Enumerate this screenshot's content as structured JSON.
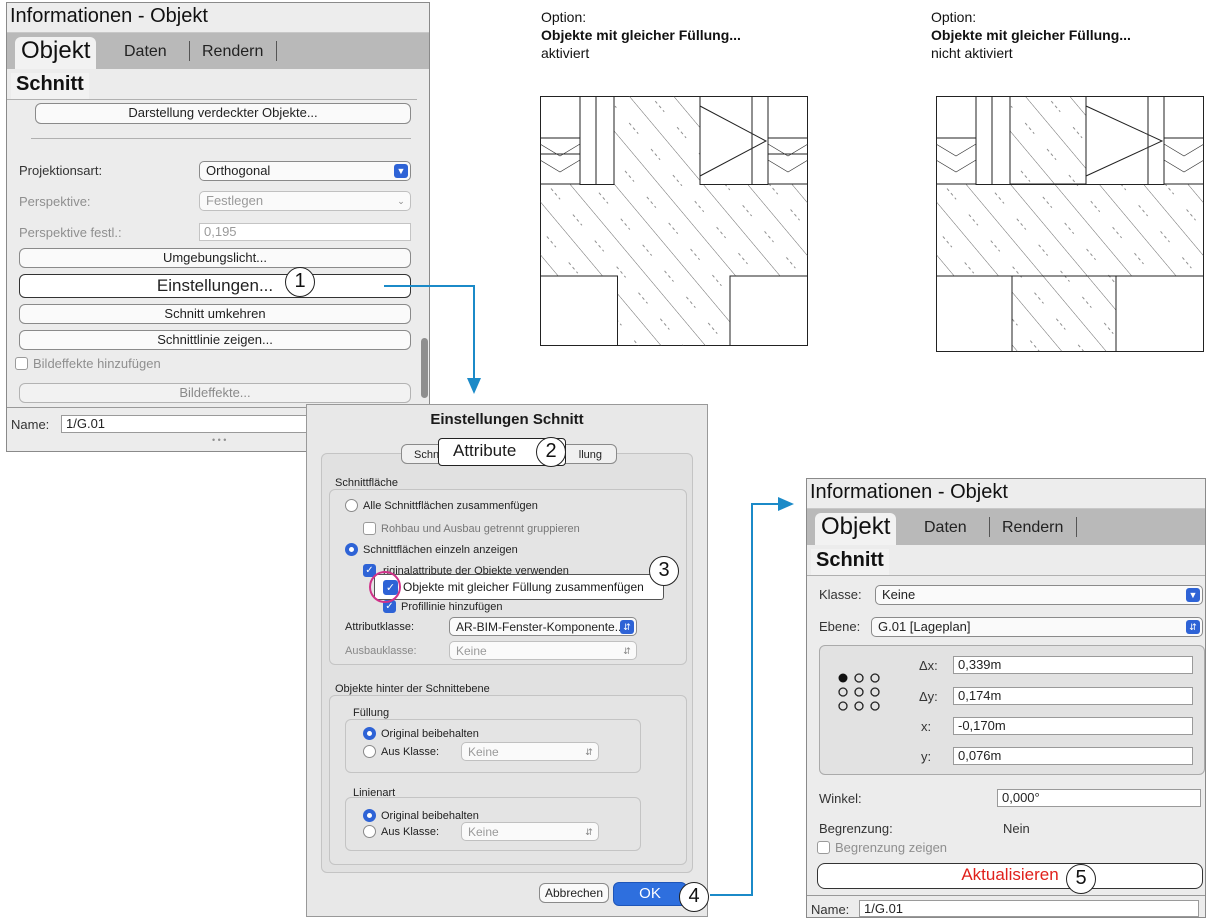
{
  "left_panel": {
    "title": "Informationen - Objekt",
    "tabs": [
      "Objekt",
      "Daten",
      "Rendern"
    ],
    "subtab": "Schnitt",
    "buttons": {
      "hidden_objects": "Darstellung verdeckter Objekte...",
      "ambient_light": "Umgebungslicht...",
      "settings": "Einstellungen...",
      "reverse": "Schnitt umkehren",
      "show_line": "Schnittlinie zeigen...",
      "effects": "Bildeffekte..."
    },
    "projection": {
      "label": "Projektionsart:",
      "value": "Orthogonal"
    },
    "perspective": {
      "label": "Perspektive:",
      "value": "Festlegen"
    },
    "perspective_fixed": {
      "label": "Perspektive festl.:",
      "value": "0,195"
    },
    "add_effects": "Bildeffekte hinzufügen",
    "name": {
      "label": "Name:",
      "value": "1/G.01"
    }
  },
  "dialog": {
    "title": "Einstellungen Schnitt",
    "tab_left_fragment": "Schni",
    "tab_right_fragment": "llung",
    "tab_active": "Attribute",
    "section_cut": "Schnittfläche",
    "merge_all": "Alle Schnittflächen zusammenfügen",
    "group_separate": "Rohbau und Ausbau getrennt gruppieren",
    "show_individually": "Schnittflächen einzeln anzeigen",
    "use_original": "riginalattribute der Objekte verwenden",
    "merge_same_fill": "Objekte mit gleicher Füllung zusammenfügen",
    "add_profile": "Profillinie hinzufügen",
    "attr_class": {
      "label": "Attributklasse:",
      "value": "AR-BIM-Fenster-Komponente..."
    },
    "finish_class": {
      "label": "Ausbauklasse:",
      "value": "Keine"
    },
    "section_behind": "Objekte hinter der Schnittebene",
    "fill_group": "Füllung",
    "line_group": "Linienart",
    "keep_original": "Original beibehalten",
    "from_class": "Aus Klasse:",
    "class_none": "Keine",
    "cancel": "Abbrechen",
    "ok": "OK"
  },
  "right_panel": {
    "title": "Informationen - Objekt",
    "tabs": [
      "Objekt",
      "Daten",
      "Rendern"
    ],
    "subtab": "Schnitt",
    "klasse": {
      "label": "Klasse:",
      "value": "Keine"
    },
    "ebene": {
      "label": "Ebene:",
      "value": "G.01 [Lageplan]"
    },
    "coords": [
      {
        "label": "Δx:",
        "value": "0,339m"
      },
      {
        "label": "Δy:",
        "value": "0,174m"
      },
      {
        "label": "x:",
        "value": "-0,170m"
      },
      {
        "label": "y:",
        "value": "0,076m"
      }
    ],
    "winkel": {
      "label": "Winkel:",
      "value": "0,000°"
    },
    "begrenzung": {
      "label": "Begrenzung:",
      "value": "Nein"
    },
    "show_bounds": "Begrenzung zeigen",
    "update": "Aktualisieren",
    "name": {
      "label": "Name:",
      "value": "1/G.01"
    }
  },
  "options": [
    {
      "prefix": "Option:",
      "bold": "Objekte mit gleicher Füllung...",
      "state": "aktiviert"
    },
    {
      "prefix": "Option:",
      "bold": "Objekte mit gleicher Füllung...",
      "state": "nicht aktiviert"
    }
  ],
  "callouts": [
    "1",
    "2",
    "3",
    "4",
    "5"
  ],
  "colors": {
    "accent": "#2e63d6",
    "arrow": "#1b8ac8",
    "highlight_ring": "#d0338a",
    "update_text": "#e0201b"
  }
}
